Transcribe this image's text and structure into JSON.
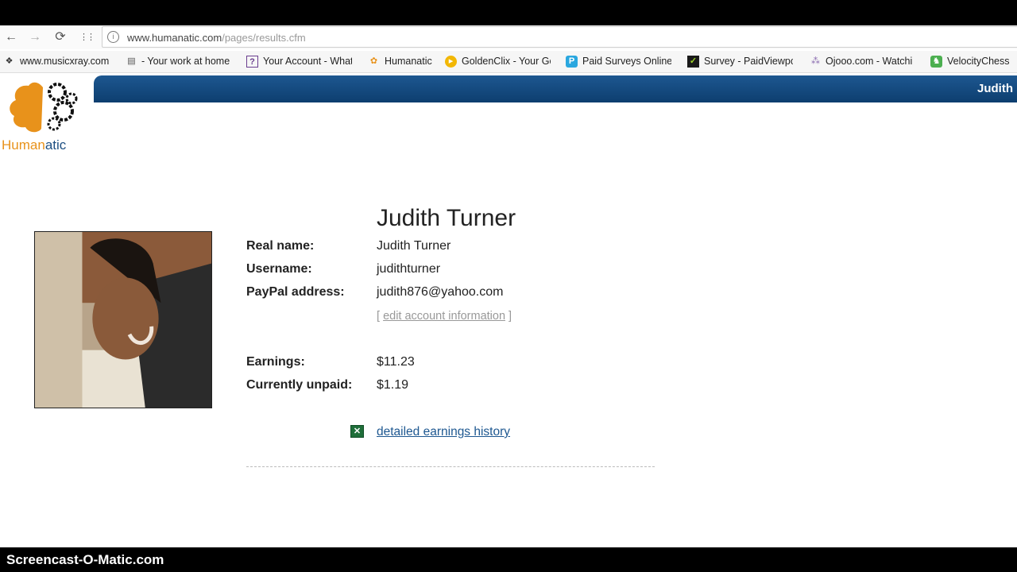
{
  "browser": {
    "nav": {
      "back": "←",
      "forward": "→",
      "reload": "⟳",
      "apps": "⋮⋮"
    },
    "url_host": "www.humanatic.com",
    "url_path": "/pages/results.cfm",
    "bookmarks": [
      {
        "label": "www.musicxray.com",
        "icon": "music-icon"
      },
      {
        "label": "- Your work at home",
        "icon": "page-icon"
      },
      {
        "label": "Your Account - What",
        "icon": "question-icon"
      },
      {
        "label": "Humanatic",
        "icon": "humanatic-icon"
      },
      {
        "label": "GoldenClix - Your Go",
        "icon": "goldenclix-icon"
      },
      {
        "label": "Paid Surveys Online |",
        "icon": "paidsurveys-icon"
      },
      {
        "label": "Survey - PaidViewpoi",
        "icon": "checkmark-icon"
      },
      {
        "label": "Ojooo.com - Watchi",
        "icon": "ojooo-icon"
      },
      {
        "label": "VelocityChess",
        "icon": "chess-icon"
      }
    ]
  },
  "site": {
    "logo_text_a": "Human",
    "logo_text_b": "atic",
    "header_user": "Judith"
  },
  "profile": {
    "heading": "Judith Turner",
    "labels": {
      "real_name": "Real name:",
      "username": "Username:",
      "paypal": "PayPal address:",
      "earnings": "Earnings:",
      "unpaid": "Currently unpaid:"
    },
    "values": {
      "real_name": "Judith Turner",
      "username": "judithturner",
      "paypal": "judith876@yahoo.com",
      "earnings": "$11.23",
      "unpaid": "$1.19"
    },
    "edit_bracket_open": "[",
    "edit_link": "edit account information",
    "edit_bracket_close": "]",
    "history_link": "detailed earnings history"
  },
  "watermark": "Screencast-O-Matic.com",
  "colors": {
    "header_bar": "#1d5790",
    "logo_orange": "#e8921b",
    "link": "#1d5790"
  }
}
